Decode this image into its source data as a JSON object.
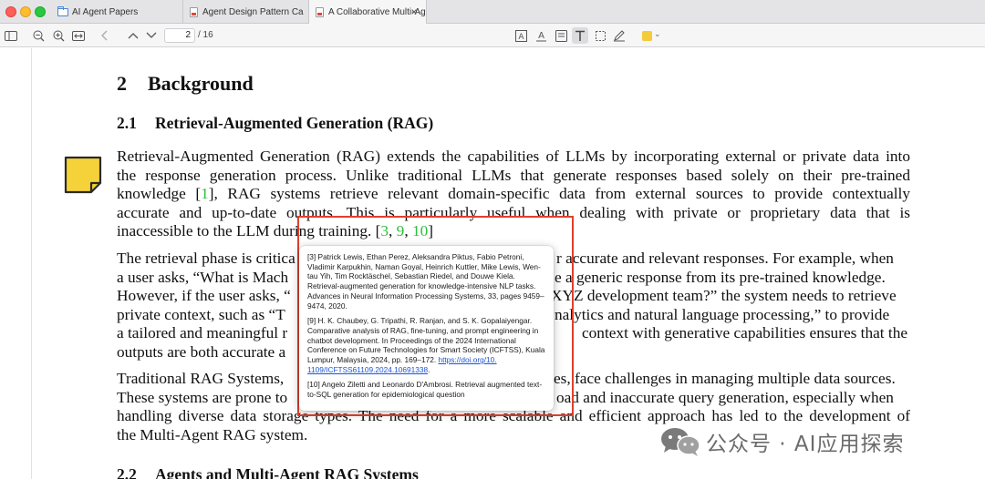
{
  "tabs": [
    {
      "label": "AI Agent Papers",
      "icon": "folder-icon"
    },
    {
      "label": "Agent Design Pattern Ca",
      "icon": "pdf-icon"
    },
    {
      "label": "A Collaborative Multi-Ag",
      "icon": "pdf-icon",
      "close": "×"
    }
  ],
  "toolbar": {
    "page_current": "2",
    "page_total": "/ 16",
    "highlight_color": "#f4cb3a"
  },
  "document": {
    "section": {
      "number": "2",
      "title": "Background"
    },
    "subsection": {
      "number": "2.1",
      "title": "Retrieval-Augmented Generation (RAG)"
    },
    "subsection2": {
      "number": "2.2",
      "title": "Agents and Multi-Agent RAG Systems"
    },
    "p1": {
      "l1": "Retrieval-Augmented Generation (RAG) extends the capabilities of LLMs by incorporating external or private data into",
      "l2": "the response generation process. Unlike traditional LLMs that generate responses based solely on their pre-trained",
      "l3_a": "knowledge [",
      "l3_cite": "1",
      "l3_b": "], RAG systems retrieve relevant domain-specific data from external sources to provide contextually",
      "l4": "accurate and up-to-date outputs. This is particularly useful when dealing with private or proprietary data that is",
      "l5_a": "inaccessible to the LLM during training. [",
      "l5_c1": "3",
      "l5_sep1": ", ",
      "l5_c2": "9",
      "l5_sep2": ", ",
      "l5_c3": "10",
      "l5_b": "]"
    },
    "p2": {
      "l1_a": "The retrieval phase is critica",
      "l1_b": "r accurate and relevant responses. For example, when",
      "l2_a": "a user asks, “What is Mach",
      "l2_b": "e a generic response from its pre-trained knowledge.",
      "l3_a": "However, if the user asks, “",
      "l3_b": "XYZ development team?” the system needs to retrieve",
      "l4_a": "private context, such as “T",
      "l4_b": "nalytics and natural language processing,” to provide",
      "l5_a": "a tailored and meaningful r",
      "l5_b": "context with generative capabilities ensures that the",
      "l6_a": "outputs are both accurate a"
    },
    "p3": {
      "l1_a": "Traditional RAG Systems, ",
      "l1_b": "es, face challenges in managing multiple data sources.",
      "l2_a": "These systems are prone to",
      "l2_b": "oad and inaccurate query generation, especially when",
      "l3": "handling diverse data storage types. The need for a more scalable and efficient approach has led to the development of",
      "l4": "the Multi-Agent RAG system."
    }
  },
  "popover": {
    "refs": [
      {
        "text": "[3] Patrick Lewis, Ethan Perez, Aleksandra Piktus, Fabio Petroni, Vladimir Karpukhin, Naman Goyal, Heinrich Kuttler, Mike Lewis, Wen-tau Yih, Tim Rocktäschel, Sebastian Riedel, and Douwe Kiela. Retrieval-augmented generation for knowledge-intensive NLP tasks. Advances in Neural Information Processing Systems, 33, pages 9459–9474, 2020."
      },
      {
        "text": "[9] H. K. Chaubey, G. Tripathi, R. Ranjan, and S. K. Gopalaiyengar. Comparative analysis of RAG, fine-tuning, and prompt engineering in chatbot development. In Proceedings of the 2024 International Conference on Future Technologies for Smart Society (ICFTSS), Kuala Lumpur, Malaysia, 2024, pp. 169–172. ",
        "link": "https://doi.org/10. 1109/ICFTSS61109.2024.10691338",
        "tail": "."
      },
      {
        "text": "[10] Angelo Ziletti and Leonardo D'Ambrosi. Retrieval augmented text-to-SQL generation for epidemiological question"
      }
    ]
  },
  "watermark": {
    "text": "公众号 · AI应用探索"
  }
}
